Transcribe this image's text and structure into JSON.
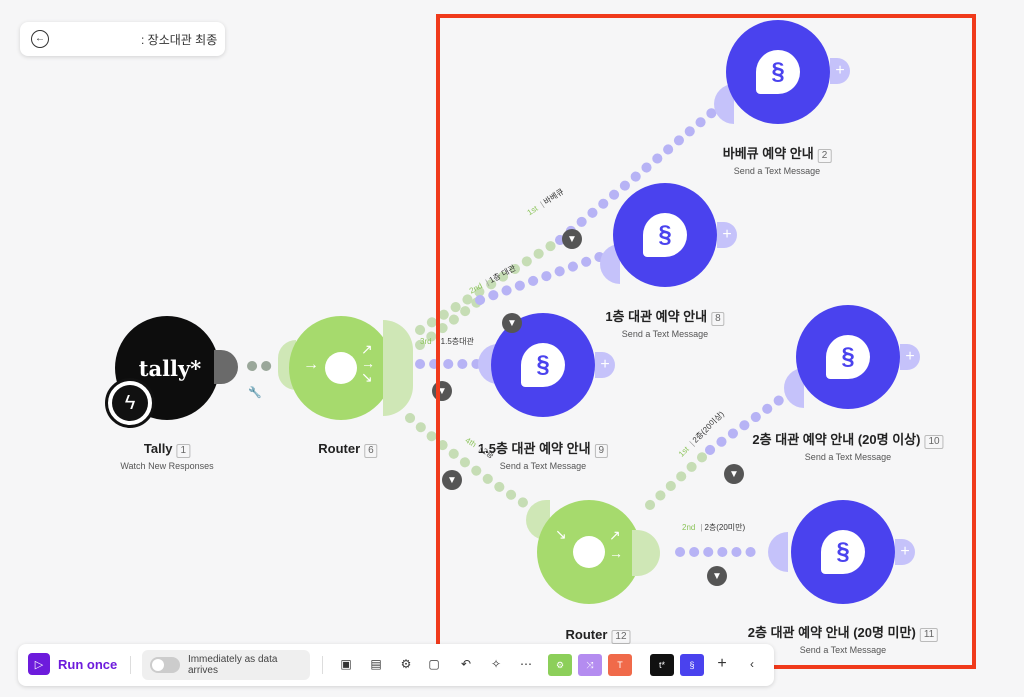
{
  "header": {
    "title": ": 장소대관 최종",
    "back_icon": "back-arrow-icon"
  },
  "colors": {
    "sms": "#4a42ee",
    "router": "#a6da6d",
    "tally": "#0d0d0d",
    "selection": "#f03a1b",
    "run": "#6d1bdc"
  },
  "nodes": {
    "tally": {
      "logo": "tally*",
      "name": "Tally",
      "num": "1",
      "sub": "Watch New Responses"
    },
    "router6": {
      "name": "Router",
      "num": "6"
    },
    "router12": {
      "name": "Router",
      "num": "12"
    },
    "sms2": {
      "name": "바베큐 예약 안내",
      "num": "2",
      "sub": "Send a Text Message"
    },
    "sms8": {
      "name": "1층 대관 예약 안내",
      "num": "8",
      "sub": "Send a Text Message"
    },
    "sms9": {
      "name": "1.5층 대관 예약 안내",
      "num": "9",
      "sub": "Send a Text Message"
    },
    "sms10": {
      "name": "2층 대관 예약 안내 (20명 이상)",
      "num": "10",
      "sub": "Send a Text Message"
    },
    "sms11": {
      "name": "2층 대관 예약 안내 (20명 미만)",
      "num": "11",
      "sub": "Send a Text Message"
    }
  },
  "routes": {
    "r1": {
      "ord": "1st",
      "label": "바베큐"
    },
    "r2": {
      "ord": "2nd",
      "label": "1층 대관"
    },
    "r3": {
      "ord": "3rd",
      "label": "1.5층대관"
    },
    "r4": {
      "ord": "4th",
      "label": "2층"
    },
    "r5": {
      "ord": "1st",
      "label": "2층(20이상)"
    },
    "r6": {
      "ord": "2nd",
      "label": "2층(20미만)"
    }
  },
  "toolbar": {
    "run_label": "Run once",
    "schedule_label": "Immediately as data arrives"
  }
}
